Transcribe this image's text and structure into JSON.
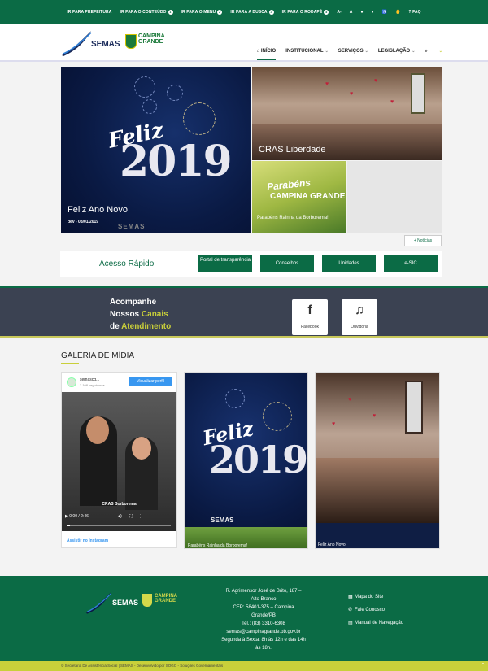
{
  "topbar": {
    "items": [
      {
        "label": "IR PARA PREFEITURA",
        "key": ""
      },
      {
        "label": "IR PARA O CONTEÚDO",
        "key": "1"
      },
      {
        "label": "IR PARA O MENU",
        "key": "2"
      },
      {
        "label": "IR PARA A BUSCA",
        "key": "3"
      },
      {
        "label": "IR PARA O RODAPÉ",
        "key": "4"
      }
    ],
    "font_smaller": "A-",
    "font_larger": "A",
    "faq": "FAQ"
  },
  "logo": {
    "semas": "SEMAS",
    "cg_line1": "CAMPINA",
    "cg_line2": "GRANDE"
  },
  "nav": {
    "home": "INÍCIO",
    "institucional": "INSTITUCIONAL",
    "servicos": "SERVIÇOS",
    "legislacao": "LEGISLAÇÃO"
  },
  "hero": {
    "main": {
      "feliz": "Feliz",
      "year": "2019",
      "title": "Feliz Ano Novo",
      "date": "dev - 08/01/2019",
      "footer": "SEMAS"
    },
    "side1": {
      "title": "CRAS Liberdade"
    },
    "side2": {
      "word": "Parabéns",
      "cg": "CAMPINA GRANDE",
      "title": "Parabéns Rainha da Borborema!"
    }
  },
  "noticias_button": "+ Notícias",
  "acesso": {
    "label": "Acesso Rápido",
    "buttons": [
      "Portal de transparência",
      "Conselhos",
      "Unidades",
      "e-SIC"
    ]
  },
  "canais": {
    "line1": "Acompanhe",
    "line2a": "Nossos ",
    "line2b": "Canais",
    "line3a": "de ",
    "line3b": "Atendimento",
    "facebook": "Facebook",
    "ouvidoria": "Ouvidoria"
  },
  "galeria": {
    "title": "GALERIA DE MÍDIA",
    "insta": {
      "name": "semascg...",
      "followers": "2.108 seguidores",
      "view_button": "Visualizar perfil",
      "caption": "CRAS Borborema",
      "time": "0:00 / 2:46",
      "link": "Assistir no Instagram"
    },
    "card2": {
      "feliz": "Feliz",
      "year": "2019",
      "footer": "SEMAS",
      "caption": "Parabéns Rainha da Borborema!"
    },
    "card3": {
      "caption": "Feliz Ano Novo"
    }
  },
  "footer": {
    "address": [
      "R. Agrimensor José de Brito, 187 –",
      "Alto Branco",
      "CEP: 58401-375 – Campina",
      "Grande/PB",
      "Tel.: (83) 3310-6308",
      "semas@campinagrande.pb.gov.br",
      "Segunda à Sexta: 8h às 12h e das 14h",
      "às 18h."
    ],
    "links": [
      "Mapa do Site",
      "Fale Conosco",
      "Manual de Navegação"
    ],
    "copyright": "© Secretaria De Assistência Social | SEMAS - Desenvolvido por SOGO - Soluções Governamentais"
  },
  "colors": {
    "primary": "#0b6b45",
    "accent": "#c9cf3a",
    "dark": "#3b4252"
  }
}
